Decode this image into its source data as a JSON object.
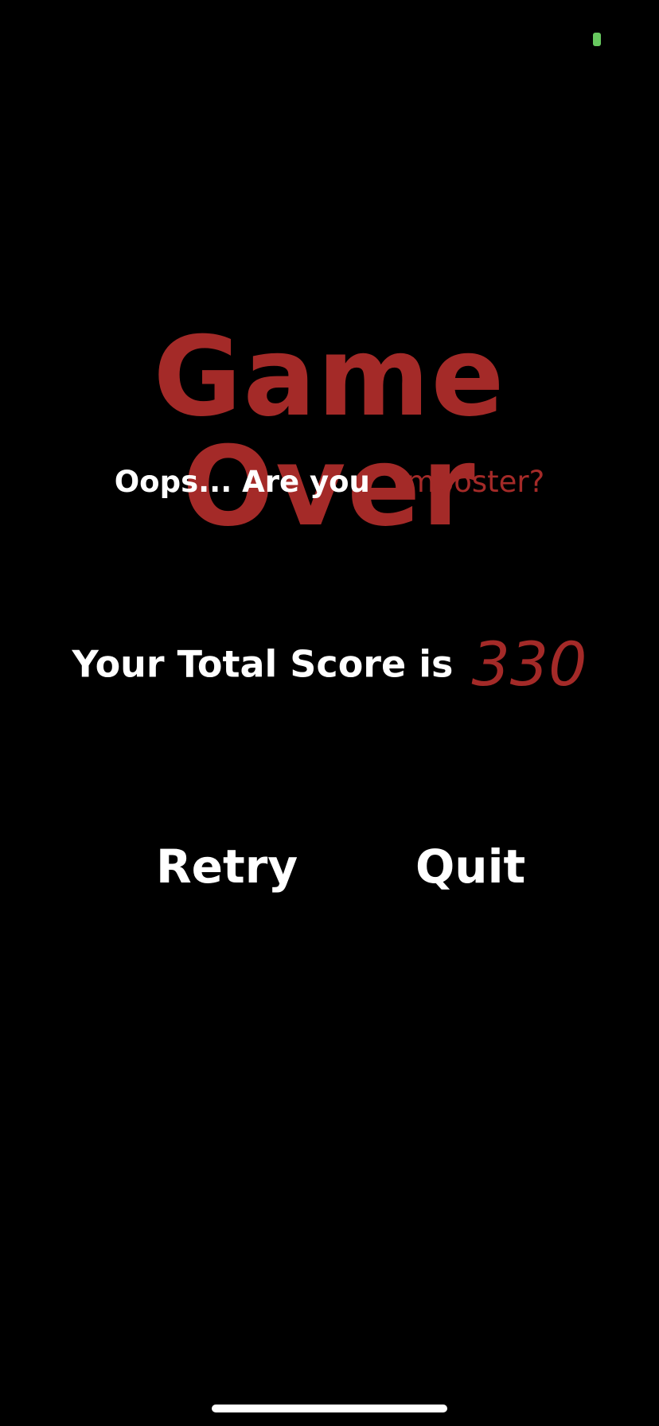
{
  "status": {
    "indicator_color": "#67c85f"
  },
  "game_over": {
    "title": "Game Over",
    "subtitle_prefix": "Oops... Are you",
    "subtitle_highlight": "Imposter?",
    "score_label": "Your Total Score is",
    "score_value": "330"
  },
  "actions": {
    "retry_label": "Retry",
    "quit_label": "Quit"
  },
  "colors": {
    "background": "#000000",
    "accent_red": "#a42a28",
    "text_white": "#ffffff"
  }
}
